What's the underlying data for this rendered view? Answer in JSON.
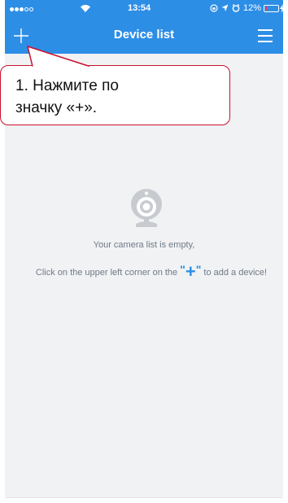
{
  "status_bar": {
    "time": "13:54",
    "battery_percent": "12%",
    "battery_level": 0.12
  },
  "nav": {
    "title": "Device list"
  },
  "callout": {
    "line1": "1. Нажмите по",
    "line2": "значку «+»."
  },
  "empty_state": {
    "message": "Your camera list is empty,",
    "hint_before": "Click on the upper left corner on the ",
    "hint_quote_open": "\"",
    "hint_plus": "+",
    "hint_quote_close": "\"",
    "hint_after": " to add a device!"
  },
  "colors": {
    "header_blue": "#2d8ee6",
    "background": "#f1f2f4",
    "callout_border": "#c8102e",
    "text_gray": "#6f7a86",
    "battery_low": "#ff3b58"
  },
  "icons": {
    "add": "plus-icon",
    "menu": "hamburger-menu-icon",
    "empty": "camera-icon"
  }
}
